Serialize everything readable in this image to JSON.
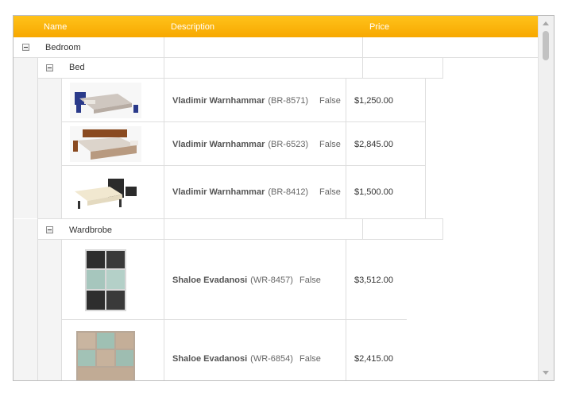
{
  "columns": {
    "name": "Name",
    "description": "Description",
    "price": "Price"
  },
  "groups": {
    "bedroom": "Bedroom",
    "bed": "Bed",
    "wardrobe": "Wardbrobe"
  },
  "beds": [
    {
      "name": "Vladimir Warnhammar",
      "code": "(BR-8571)",
      "flag": "False",
      "price": "$1,250.00"
    },
    {
      "name": "Vladimir Warnhammar",
      "code": "(BR-6523)",
      "flag": "False",
      "price": "$2,845.00"
    },
    {
      "name": "Vladimir Warnhammar",
      "code": "(BR-8412)",
      "flag": "False",
      "price": "$1,500.00"
    }
  ],
  "wardrobes": [
    {
      "name": "Shaloe Evadanosi",
      "code": "(WR-8457)",
      "flag": "False",
      "price": "$3,512.00"
    },
    {
      "name": "Shaloe Evadanosi",
      "code": "(WR-6854)",
      "flag": "False",
      "price": "$2,415.00"
    }
  ],
  "colors": {
    "header": "#f7a800",
    "header_text": "#ffffff",
    "border": "#dedede"
  }
}
